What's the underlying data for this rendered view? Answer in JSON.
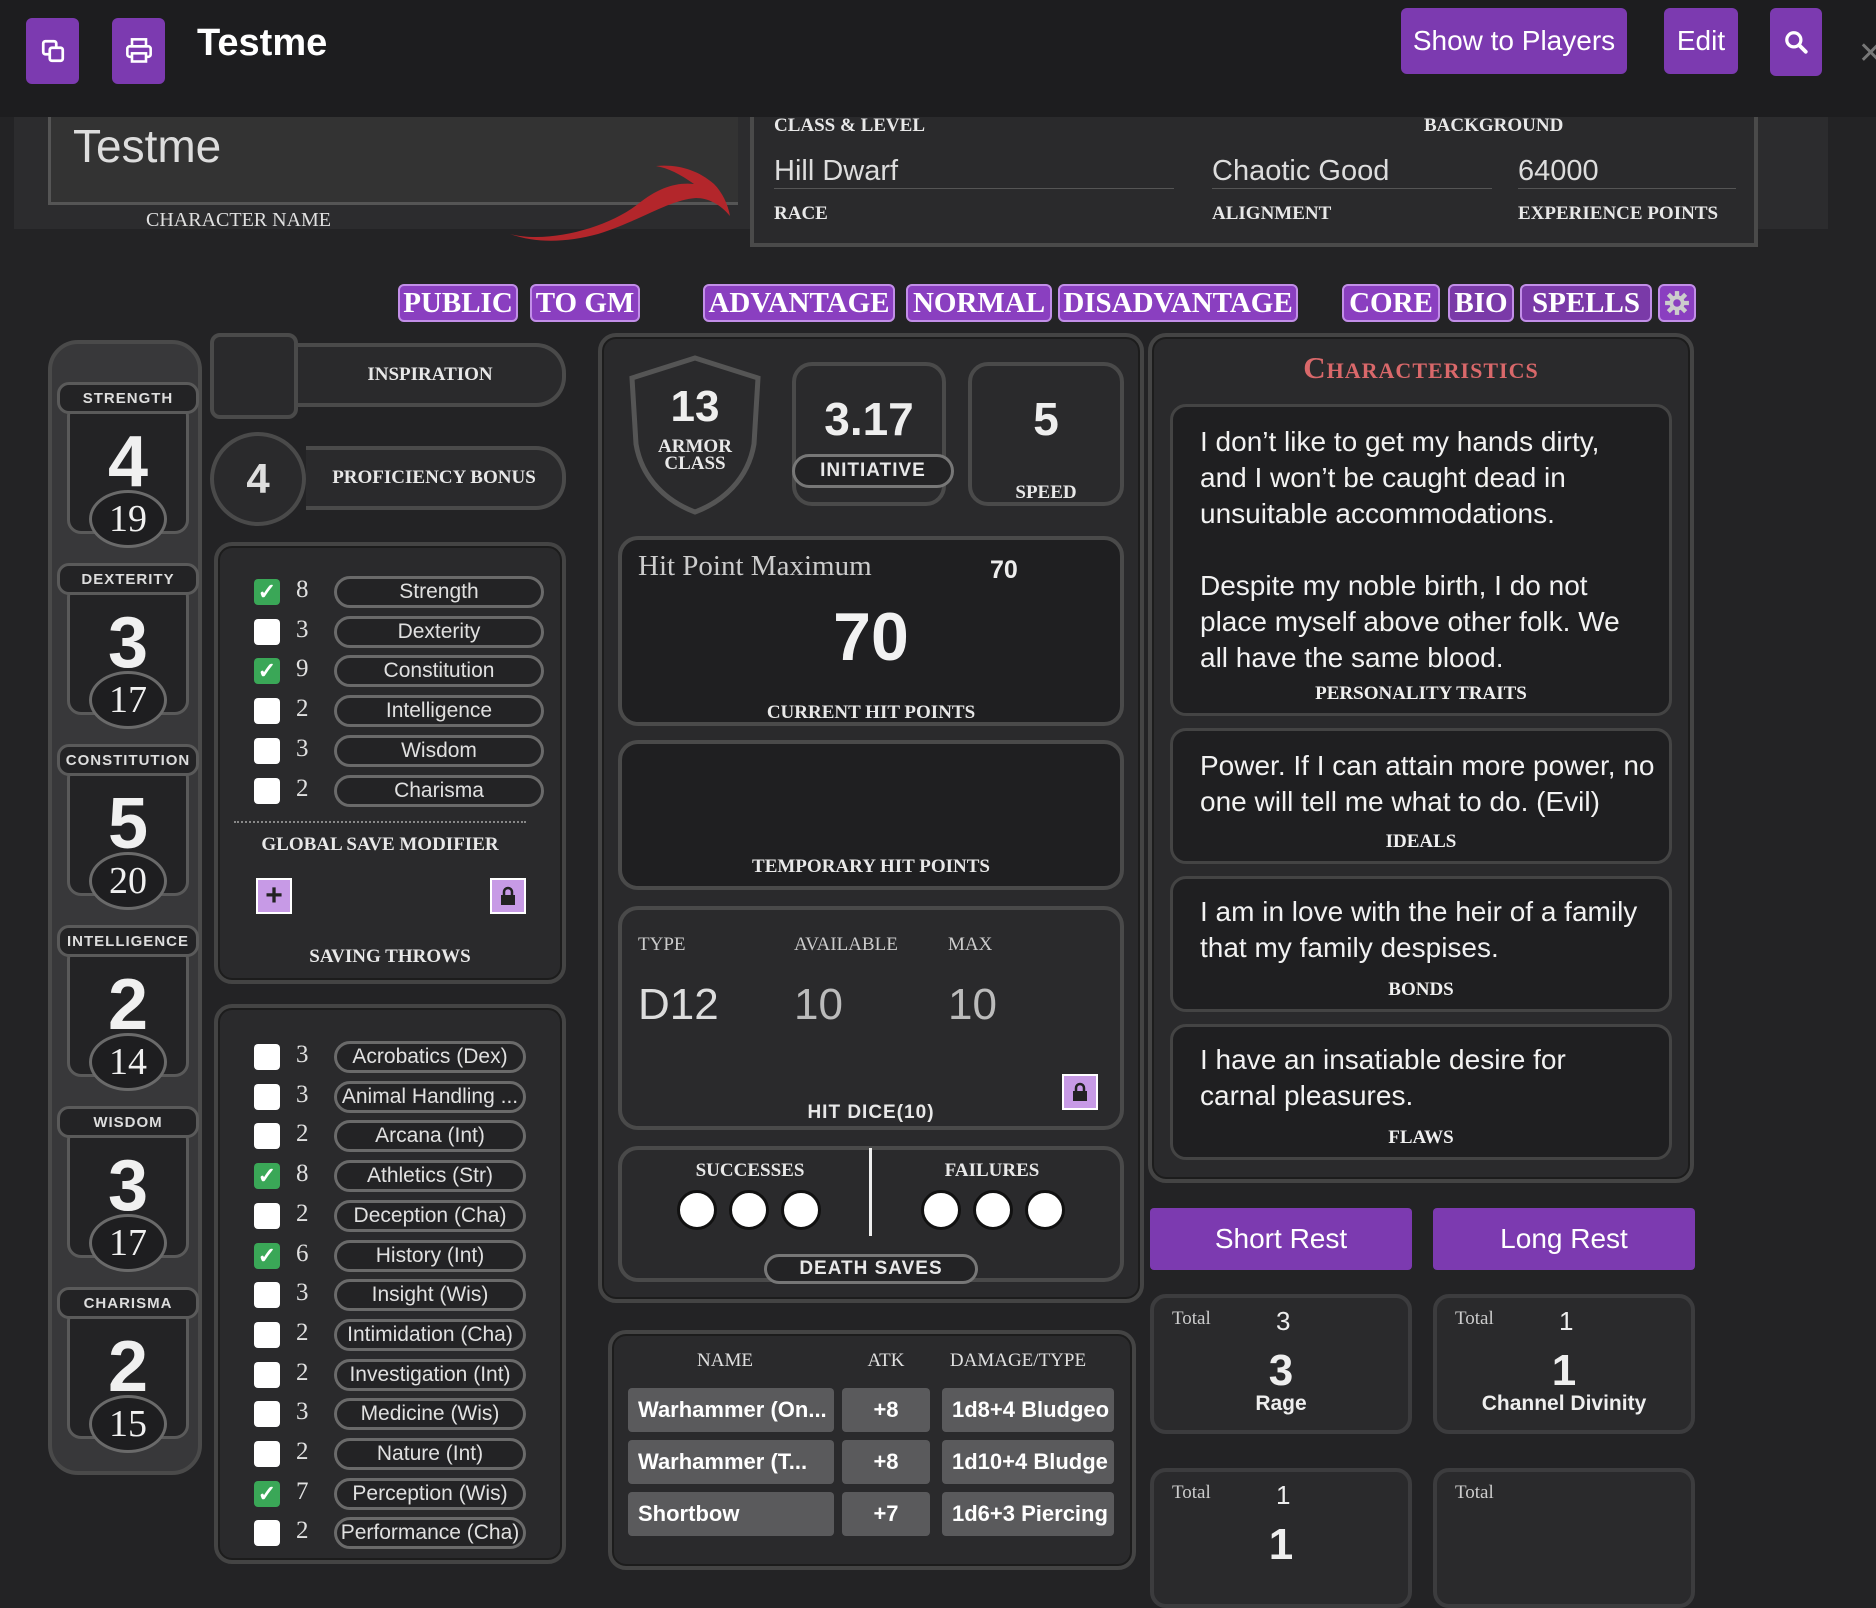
{
  "header": {
    "title": "Testme",
    "show_players": "Show to Players",
    "edit": "Edit"
  },
  "banner": {
    "character_name": "Testme",
    "character_name_label": "CHARACTER NAME",
    "class_level_label": "CLASS & LEVEL",
    "background_label": "BACKGROUND",
    "race": "Hill Dwarf",
    "race_label": "RACE",
    "alignment": "Chaotic Good",
    "alignment_label": "ALIGNMENT",
    "xp": "64000",
    "xp_label": "EXPERIENCE POINTS"
  },
  "toolbar": {
    "public": "PUBLIC",
    "to_gm": "TO GM",
    "advantage": "ADVANTAGE",
    "normal": "NORMAL",
    "disadvantage": "DISADVANTAGE",
    "core": "CORE",
    "bio": "BIO",
    "spells": "SPELLS"
  },
  "abilities": [
    {
      "name": "STRENGTH",
      "mod": "4",
      "score": "19"
    },
    {
      "name": "DEXTERITY",
      "mod": "3",
      "score": "17"
    },
    {
      "name": "CONSTITUTION",
      "mod": "5",
      "score": "20"
    },
    {
      "name": "INTELLIGENCE",
      "mod": "2",
      "score": "14"
    },
    {
      "name": "WISDOM",
      "mod": "3",
      "score": "17"
    },
    {
      "name": "CHARISMA",
      "mod": "2",
      "score": "15"
    }
  ],
  "inspiration_label": "INSPIRATION",
  "proficiency": {
    "value": "4",
    "label": "PROFICIENCY BONUS"
  },
  "saving_throws": {
    "rows": [
      {
        "checked": true,
        "value": "8",
        "label": "Strength"
      },
      {
        "checked": false,
        "value": "3",
        "label": "Dexterity"
      },
      {
        "checked": true,
        "value": "9",
        "label": "Constitution"
      },
      {
        "checked": false,
        "value": "2",
        "label": "Intelligence"
      },
      {
        "checked": false,
        "value": "3",
        "label": "Wisdom"
      },
      {
        "checked": false,
        "value": "2",
        "label": "Charisma"
      }
    ],
    "global_label": "GLOBAL SAVE MODIFIER",
    "label": "SAVING THROWS"
  },
  "skills": [
    {
      "checked": false,
      "value": "3",
      "label": "Acrobatics (Dex)"
    },
    {
      "checked": false,
      "value": "3",
      "label": "Animal Handling ..."
    },
    {
      "checked": false,
      "value": "2",
      "label": "Arcana (Int)"
    },
    {
      "checked": true,
      "value": "8",
      "label": "Athletics (Str)"
    },
    {
      "checked": false,
      "value": "2",
      "label": "Deception (Cha)"
    },
    {
      "checked": true,
      "value": "6",
      "label": "History (Int)"
    },
    {
      "checked": false,
      "value": "3",
      "label": "Insight (Wis)"
    },
    {
      "checked": false,
      "value": "2",
      "label": "Intimidation (Cha)"
    },
    {
      "checked": false,
      "value": "2",
      "label": "Investigation (Int)"
    },
    {
      "checked": false,
      "value": "3",
      "label": "Medicine (Wis)"
    },
    {
      "checked": false,
      "value": "2",
      "label": "Nature (Int)"
    },
    {
      "checked": true,
      "value": "7",
      "label": "Perception (Wis)"
    },
    {
      "checked": false,
      "value": "2",
      "label": "Performance (Cha)"
    }
  ],
  "combat": {
    "ac": "13",
    "ac_label": "ARMOR CLASS",
    "initiative": "3.17",
    "initiative_label": "INITIATIVE",
    "speed": "5",
    "speed_label": "SPEED",
    "hp_max_label": "Hit Point Maximum",
    "hp_max": "70",
    "hp_current": "70",
    "hp_current_label": "CURRENT HIT POINTS",
    "temp_label": "TEMPORARY HIT POINTS",
    "dice_type_label": "TYPE",
    "dice_available_label": "AVAILABLE",
    "dice_max_label": "MAX",
    "dice_type": "D12",
    "dice_available": "10",
    "dice_max": "10",
    "hit_dice_label": "HIT DICE(10)",
    "successes_label": "SUCCESSES",
    "failures_label": "FAILURES",
    "death_saves_label": "DEATH SAVES"
  },
  "attacks": {
    "headers": [
      "NAME",
      "ATK",
      "DAMAGE/TYPE"
    ],
    "rows": [
      {
        "name": "Warhammer (On...",
        "atk": "+8",
        "damage": "1d8+4 Bludgeo"
      },
      {
        "name": "Warhammer (T...",
        "atk": "+8",
        "damage": "1d10+4 Bludge"
      },
      {
        "name": "Shortbow",
        "atk": "+7",
        "damage": "1d6+3 Piercing"
      }
    ]
  },
  "characteristics": {
    "title": "Characteristics",
    "personality": "I don’t like to get my hands dirty, and I won’t be caught dead in unsuitable accommodations.\n\nDespite my noble birth, I do not place myself above other folk. We all have the same blood.",
    "personality_label": "PERSONALITY TRAITS",
    "ideals": "Power. If I can attain more power, no one will tell me what to do. (Evil)",
    "ideals_label": "IDEALS",
    "bonds": "I am in love with the heir of a family that my family despises.",
    "bonds_label": "BONDS",
    "flaws": "I have an insatiable desire for carnal pleasures.",
    "flaws_label": "FLAWS"
  },
  "rest": {
    "short": "Short Rest",
    "long": "Long Rest"
  },
  "resources": [
    {
      "total_label": "Total",
      "total": "3",
      "value": "3",
      "name": "Rage"
    },
    {
      "total_label": "Total",
      "total": "1",
      "value": "1",
      "name": "Channel Divinity"
    },
    {
      "total_label": "Total",
      "total": "1",
      "value": "1",
      "name": ""
    },
    {
      "total_label": "Total",
      "total": "",
      "value": "",
      "name": ""
    }
  ],
  "icons": {
    "copy": "copy-icon",
    "print": "print-icon",
    "search": "search-icon",
    "gear": "gear-icon",
    "lock": "lock-icon",
    "plus": "plus-icon",
    "close": "close-icon"
  },
  "colors": {
    "accent": "#7c3ab0",
    "check": "#3aa757",
    "title_red": "#d9686a",
    "dragon_red": "#b3262b"
  }
}
